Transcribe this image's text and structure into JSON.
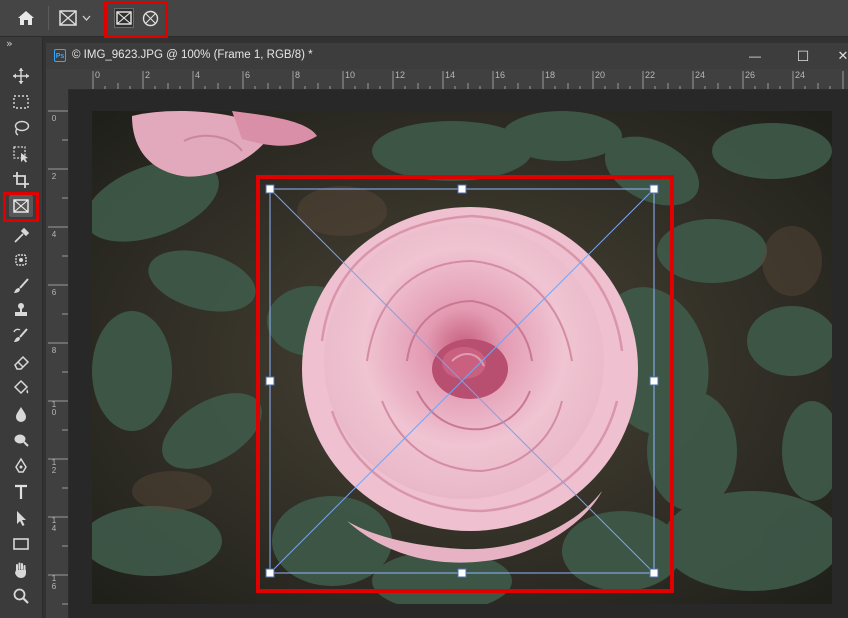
{
  "app": {
    "options_bar": {
      "home_icon": "home-icon",
      "preset_icon": "frame-tool-icon",
      "preset_dropdown_icon": "chevron-down-icon",
      "rect_frame_icon": "rectangle-frame-icon",
      "ellipse_frame_icon": "ellipse-frame-icon"
    },
    "toolbar": {
      "collapse_glyph": "»",
      "tools": [
        {
          "name": "move-tool",
          "icon": "move-icon"
        },
        {
          "name": "marquee-tool",
          "icon": "rect-marquee-icon"
        },
        {
          "name": "lasso-tool",
          "icon": "lasso-icon"
        },
        {
          "name": "object-selection-tool",
          "icon": "object-select-icon"
        },
        {
          "name": "crop-tool",
          "icon": "crop-icon"
        },
        {
          "name": "frame-tool",
          "icon": "frame-icon",
          "active": true
        },
        {
          "name": "eyedropper-tool",
          "icon": "eyedropper-icon"
        },
        {
          "name": "healing-tool",
          "icon": "healing-icon"
        },
        {
          "name": "brush-tool",
          "icon": "brush-icon"
        },
        {
          "name": "stamp-tool",
          "icon": "stamp-icon"
        },
        {
          "name": "history-brush-tool",
          "icon": "history-brush-icon"
        },
        {
          "name": "eraser-tool",
          "icon": "eraser-icon"
        },
        {
          "name": "paint-bucket-tool",
          "icon": "bucket-icon"
        },
        {
          "name": "blur-tool",
          "icon": "drop-icon"
        },
        {
          "name": "dodge-tool",
          "icon": "dodge-icon"
        },
        {
          "name": "pen-tool",
          "icon": "pen-icon"
        },
        {
          "name": "type-tool",
          "icon": "type-icon"
        },
        {
          "name": "path-selection-tool",
          "icon": "arrow-icon"
        },
        {
          "name": "shape-tool",
          "icon": "rectangle-icon"
        },
        {
          "name": "hand-tool",
          "icon": "hand-icon"
        },
        {
          "name": "zoom-tool",
          "icon": "magnifier-icon"
        }
      ]
    },
    "document": {
      "ps_badge": "Ps",
      "title": "© IMG_9623.JPG @ 100% (Frame 1, RGB/8) *",
      "minimize_glyph": "—",
      "maximize_glyph": "☐",
      "close_glyph": "✕",
      "h_ruler_labels": [
        "0",
        "2",
        "4",
        "6",
        "8",
        "10",
        "12",
        "14",
        "16",
        "18",
        "20",
        "22",
        "24",
        "26"
      ],
      "v_ruler_labels": [
        "0",
        "2",
        "4",
        "6",
        "8",
        "1\n0",
        "1\n2",
        "1\n4",
        "1\n6"
      ]
    },
    "colors": {
      "accent_red": "#e00000",
      "frame_guide": "#8fb6ff",
      "ps_blue": "#31a8ff"
    }
  }
}
